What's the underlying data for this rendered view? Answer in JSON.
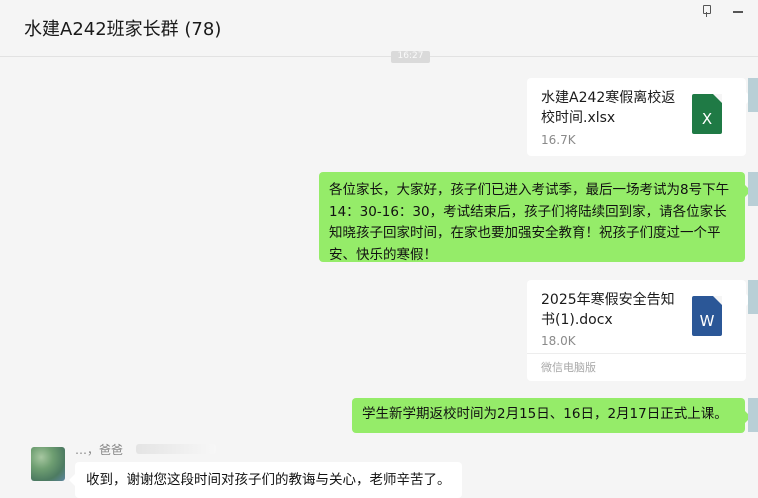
{
  "header": {
    "title": "水建A242班家长群 (78)"
  },
  "timestamp": "16:27",
  "messages": [
    {
      "kind": "file",
      "file_name": "水建A242寒假离校返校时间.xlsx",
      "file_size": "16.7K",
      "icon_letter": "X",
      "icon": "excel-icon"
    },
    {
      "kind": "text",
      "text": "各位家长，大家好，孩子们已进入考试季，最后一场考试为8号下午14：30-16：30，考试结束后，孩子们将陆续回到家，请各位家长知晓孩子回家时间，在家也要加强安全教育！祝孩子们度过一个平安、快乐的寒假！"
    },
    {
      "kind": "file",
      "file_name": "2025年寒假安全告知书(1).docx",
      "file_size": "18.0K",
      "icon_letter": "W",
      "icon": "word-icon",
      "source": "微信电脑版"
    },
    {
      "kind": "text",
      "text": "学生新学期返校时间为2月15日、16日，2月17日正式上课。"
    }
  ],
  "incoming": {
    "sender_name": "…，爸爸",
    "text": "收到，谢谢您这段时间对孩子们的教诲与关心，老师辛苦了。"
  },
  "colors": {
    "outgoing_bubble": "#95ec69",
    "incoming_bubble": "#ffffff",
    "background": "#f5f5f5",
    "excel": "#1f7a45",
    "word": "#2b5797"
  }
}
